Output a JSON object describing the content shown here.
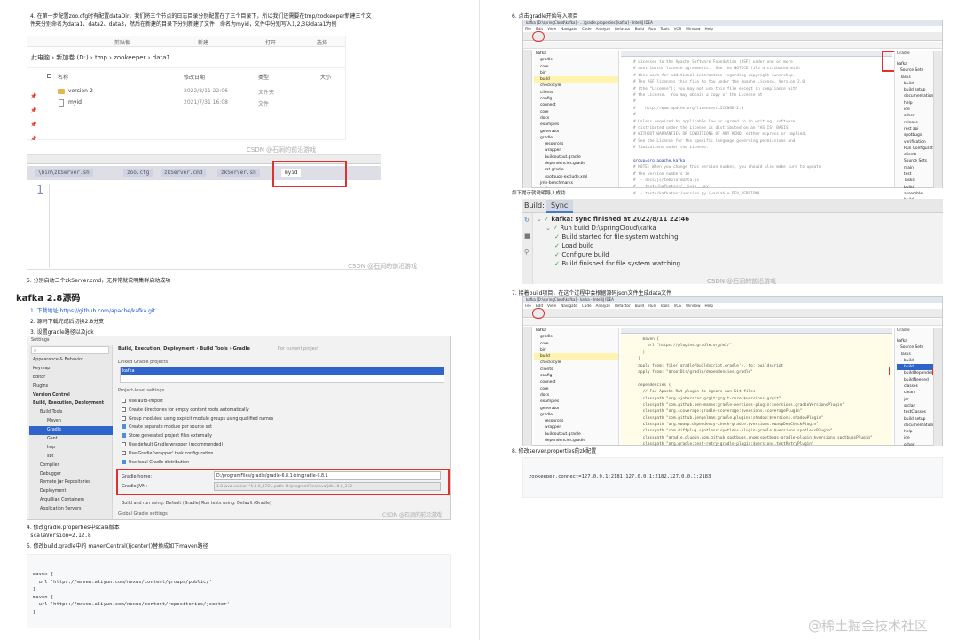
{
  "left": {
    "step4": "4. 在第一步配置zoo.cfg时有配置dataDir，我们将三个节点的日志目录分别配置在了三个目录下，所以我们还需要在tmp/zookeeper新建三个文件夹分别命名为data1、data2、data3，然后在新建的目录下分别新建了文件，命名为myid，文件中分别写入1,2,3以data1为例",
    "explorer": {
      "ribbon": [
        "剪贴板",
        "新建",
        "打开",
        "选择"
      ],
      "path": [
        "此电脑",
        "新加卷 (D:)",
        "tmp",
        "zookeeper",
        "data1"
      ],
      "columns": [
        "名称",
        "修改日期",
        "类型",
        "大小"
      ],
      "files": [
        {
          "name": "version-2",
          "date": "2022/8/11 22:06",
          "type": "文件夹"
        },
        {
          "name": "myid",
          "date": "2021/7/31 16:08",
          "type": "文件"
        }
      ]
    },
    "watermark": "CSDN @石涧的前沿游戏",
    "editor": {
      "tabs": [
        "\\bin\\zkServer.sh",
        "zoo.cfg",
        "zkServer.cmd",
        "zkServer.sh",
        "myid"
      ],
      "line_number": "1"
    },
    "step5": "5. 分别启动三个zkServer.cmd，无异常就说明集群启动成功",
    "heading": "kafka 2.8源码",
    "list1": "1. 下载地址 https://github.com/apache/kafka.git",
    "list2": "2. 源码下载完成后切换2.8分支",
    "list3": "3. 设置gradle路径以及jdk",
    "settings": {
      "title": "Settings",
      "breadcrumb": "Build, Execution, Deployment  ›  Build Tools  ›  Gradle",
      "breadcrumb_note": "For current project",
      "tree": [
        "Appearance & Behavior",
        "Keymap",
        "Editor",
        "Plugins",
        "Version Control",
        "Build, Execution, Deployment",
        "Build Tools",
        "Maven",
        "Gradle",
        "Gant",
        "Imp",
        "sbt",
        "Compiler",
        "Debugger",
        "Remote Jar Repositories",
        "Deployment",
        "Arquillian Containers",
        "Application Servers"
      ],
      "linked_label": "Linked Gradle projects",
      "linked_item": "kafka",
      "project_settings": "Project-level settings",
      "options": [
        {
          "label": "Use auto-import",
          "on": false
        },
        {
          "label": "Create directories for empty content roots automatically",
          "on": false
        },
        {
          "label": "Group modules:  using explicit module groups  using qualified names",
          "on": false
        },
        {
          "label": "Create separate module per source set",
          "on": true
        },
        {
          "label": "Store generated project files externally",
          "on": true
        },
        {
          "label": "Use default Gradle wrapper (recommended)",
          "on": false
        },
        {
          "label": "Use Gradle 'wrapper' task configuration",
          "on": false
        },
        {
          "label": "Use local Gradle distribution",
          "on": true
        }
      ],
      "gradle_home_label": "Gradle home:",
      "gradle_home": "D:/programFiles/gradle/gradle-6.8.1-bin/gradle-6.8.1",
      "gradle_jvm_label": "Gradle JVM:",
      "gradle_jvm": "1.8 java version \"1.8.0_172\", path: D:/programFiles/java/jdk1.8.0_172",
      "runner": "Build and run using: Default (Gradle)   Run tests using: Default (Gradle)",
      "global": "Global Gradle settings"
    },
    "step4b": "4. 修改gradle.properties中scala版本",
    "scala_line": "scalaVersion=2.12.8",
    "step5b": "5. 修改build.gradle中的 mavenCentral()jcenter()替换成如下maven路径",
    "code": [
      "maven {",
      "  url 'https://maven.aliyun.com/nexus/content/groups/public/'",
      "}",
      "maven {",
      "  url 'https://maven.aliyun.com/nexus/content/repositories/jcenter'",
      "}"
    ]
  },
  "right": {
    "step6": "6. 点击gradle开始导入项目",
    "ide_title": "kafka [D:\\springCloud\\kafka] - ...\\gradle.properties [kafka] - IntelliJ IDEA",
    "menu": [
      "File",
      "Edit",
      "View",
      "Navigate",
      "Code",
      "Analyze",
      "Refactor",
      "Build",
      "Run",
      "Tools",
      "VCS",
      "Window",
      "Help"
    ],
    "project_tree": [
      "kafka",
      "gradle",
      "core",
      "bin",
      "build",
      "checkstyle",
      "clients",
      "config",
      "connect",
      "core",
      "docs",
      "examples",
      "generator",
      "gradle",
      "resources",
      "wrapper",
      "buildoutput.gradle",
      "dependencies.gradle",
      "rat.gradle",
      "spotbugs-exclude.xml",
      "jmh-benchmarks",
      "kafka",
      "licenses",
      "log4j-appender"
    ],
    "editor_lines": [
      "# Licensed to the Apache Software Foundation (ASF) under one or more",
      "# contributor license agreements.  See the NOTICE file distributed with",
      "# this work for additional information regarding copyright ownership.",
      "# The ASF licenses this file to You under the Apache License, Version 2.0",
      "# (the \"License\"); you may not use this file except in compliance with",
      "# the License.  You may obtain a copy of the License at",
      "#",
      "#    http://www.apache.org/licenses/LICENSE-2.0",
      "#",
      "# Unless required by applicable law or agreed to in writing, software",
      "# distributed under the License is distributed on an \"AS IS\" BASIS,",
      "# WITHOUT WARRANTIES OR CONDITIONS OF ANY KIND, either express or implied.",
      "# See the License for the specific language governing permissions and",
      "# limitations under the License.",
      "",
      "group=org.apache.kafka",
      "# NOTE: When you change this version number, you should also make sure to update",
      "# the version numbers in",
      "#  - docs/js/templateData.js",
      "#  - tests/kafkatest/__init__.py",
      "#  - tests/kafkatest/version.py (variable DEV_VERSION)"
    ],
    "gradle_panel_title": "Gradle",
    "gradle_tree": [
      "kafka",
      "Source Sets",
      "Tasks",
      "build",
      "build setup",
      "documentation",
      "help",
      "ide",
      "other",
      "release",
      "rest api",
      "spotbugs",
      "verification",
      "Run Configurations",
      "clients",
      "Source Sets",
      "main",
      "test",
      "Tasks",
      "build",
      "assemble",
      "build"
    ],
    "step_note": "如下提示就说明导入成功",
    "build": {
      "tab_label": "Build:",
      "tab": "Sync",
      "lines": [
        {
          "text": "kafka: sync finished at 2022/8/11 22:46",
          "indent": 0
        },
        {
          "text": "Run build D:\\springCloud\\kafka",
          "indent": 1
        },
        {
          "text": "Build started for file system watching",
          "indent": 2
        },
        {
          "text": "Load build",
          "indent": 2
        },
        {
          "text": "Configure build",
          "indent": 2
        },
        {
          "text": "Build finished for file system watching",
          "indent": 2
        }
      ]
    },
    "step7": "7. 接着build项目，在这个过程中会根据源码json文件生成data文件",
    "ide2_title": "kafka [D:\\springCloud\\kafka] - kafka - IntelliJ IDEA",
    "editor2_lines": [
      "    maven {",
      "      url \"https://plugins.gradle.org/m2/\"",
      "    }",
      "  }",
      "  apply from: file('gradle/buildscript.gradle'), to: buildscript",
      "  apply from: \"$rootDir/gradle/dependencies.gradle\"",
      "",
      "  dependencies {",
      "    // For Apache Rat plugin to ignore non-Git files",
      "    classpath \"org.ajoberstar.grgit:grgit-core:$versions.grgit\"",
      "    classpath \"com.github.ben-manes:gradle-versions-plugin:$versions.gradleVersionsPlugin\"",
      "    classpath \"org.scoverage:gradle-scoverage:$versions.scoveragePlugin\"",
      "    classpath \"com.github.jengelman.gradle.plugins:shadow:$versions.shadowPlugin\"",
      "    classpath \"org.owasp:dependency-check-gradle:$versions.owaspDepCheckPlugin\"",
      "    classpath \"com.diffplug.spotless:spotless-plugin-gradle:$versions.spotlessPlugin\"",
      "    classpath \"gradle.plugin.com.github.spotbugs.snom:spotbugs-gradle-plugin:$versions.spotbugsPlugin\"",
      "    classpath \"org.gradle:test-retry-gradle-plugin:$versions.testRetryPlugin\""
    ],
    "gradle2_tree": [
      "kafka",
      "Source Sets",
      "Tasks",
      "build",
      "build",
      "buildDependents",
      "buildNeeded",
      "classes",
      "clean",
      "jar",
      "srcJar",
      "testClasses",
      "build setup",
      "documentation",
      "help",
      "ide",
      "other"
    ],
    "step8": "8. 修改server.properties的zk配置",
    "server_line": "zookeeper.connect=127.0.0.1:2181,127.0.0.1:2182,127.0.0.1:2183"
  },
  "footer_watermark": "@稀土掘金技术社区"
}
